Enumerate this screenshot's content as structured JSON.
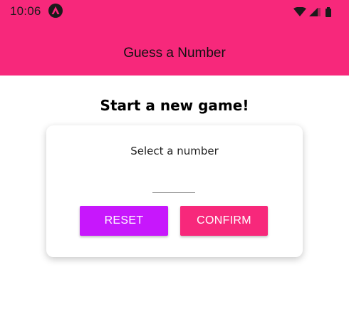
{
  "status_bar": {
    "time": "10:06",
    "icons": [
      "app-notification-icon",
      "wifi-icon",
      "signal-icon",
      "battery-icon"
    ]
  },
  "app_bar": {
    "title": "Guess a Number"
  },
  "main": {
    "heading": "Start a new game!"
  },
  "card": {
    "label": "Select a number",
    "input_value": "",
    "reset_label": "RESET",
    "confirm_label": "CONFIRM"
  },
  "colors": {
    "primary": "#f7287b",
    "accent": "#c717fc",
    "background": "#ffffff"
  }
}
